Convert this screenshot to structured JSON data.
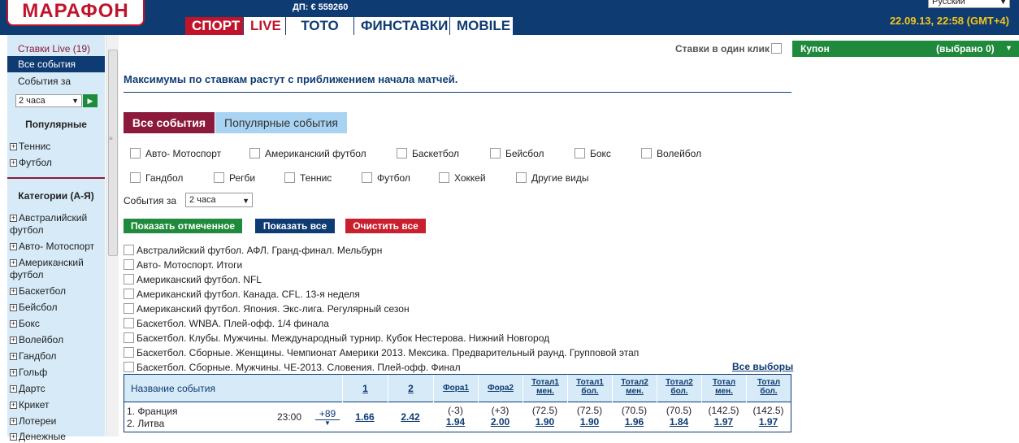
{
  "header": {
    "logo": "МАРАФОН",
    "dp": "ДП: € 559260",
    "tabs": [
      "СПОРТ",
      "LIVE",
      "ТОТО",
      "ФИНСТАВКИ",
      "MOBILE"
    ],
    "language": "Русский",
    "datetime": "22.09.13, 22:58 (GMT+4)"
  },
  "sidebar": {
    "live": "Ставки Live (19)",
    "all_events": "Все события",
    "events_for": "События за",
    "period": "2 часа",
    "popular_title": "Популярные",
    "popular": [
      "Теннис",
      "Футбол"
    ],
    "categories_title": "Категории (А-Я)",
    "categories": [
      "Австралийский футбол",
      "Авто- Мотоспорт",
      "Американский футбол",
      "Баскетбол",
      "Бейсбол",
      "Бокс",
      "Волейбол",
      "Гандбол",
      "Гольф",
      "Дартс",
      "Крикет",
      "Лотереи",
      "Денежные"
    ]
  },
  "topbar": {
    "one_click": "Ставки в один клик",
    "coupon": "Купон",
    "coupon_selected": "(выбрано 0)"
  },
  "main": {
    "notice": "Максимумы по ставкам растут с приближением начала матчей.",
    "tab_all": "Все события",
    "tab_popular": "Популярные события",
    "sports_row1": [
      "Авто- Мотоспорт",
      "Американский футбол",
      "Баскетбол",
      "Бейсбол",
      "Бокс",
      "Волейбол"
    ],
    "sports_row2": [
      "Гандбол",
      "Регби",
      "Теннис",
      "Футбол",
      "Хоккей",
      "Другие виды"
    ],
    "events_for": "События за",
    "period": "2 часа",
    "btn_show_selected": "Показать отмеченное",
    "btn_show_all": "Показать все",
    "btn_clear_all": "Очистить все",
    "events": [
      "Австралийский футбол. АФЛ. Гранд-финал. Мельбурн",
      "Авто- Мотоспорт. Итоги",
      "Американский футбол. NFL",
      "Американский футбол. Канада. CFL. 13-я неделя",
      "Американский футбол. Япония. Экс-лига. Регулярный сезон",
      "Баскетбол. WNBA. Плей-офф. 1/4 финала",
      "Баскетбол. Клубы. Мужчины. Международный турнир. Кубок Нестерова. Нижний Новгород",
      "Баскетбол. Сборные. Женщины. Чемпионат Америки 2013. Мексика. Предварительный раунд. Групповой этап",
      "Баскетбол. Сборные. Мужчины. ЧЕ-2013. Словения. Плей-офф. Финал"
    ],
    "all_choices": "Все выборы"
  },
  "table": {
    "event_name_header": "Название события",
    "columns": [
      {
        "l1": "1",
        "l2": ""
      },
      {
        "l1": "2",
        "l2": ""
      },
      {
        "l1": "Фора1",
        "l2": ""
      },
      {
        "l1": "Фора2",
        "l2": ""
      },
      {
        "l1": "Тотал1",
        "l2": "мен."
      },
      {
        "l1": "Тотал1",
        "l2": "бол."
      },
      {
        "l1": "Тотал2",
        "l2": "мен."
      },
      {
        "l1": "Тотал2",
        "l2": "бол."
      },
      {
        "l1": "Тотал",
        "l2": "мен."
      },
      {
        "l1": "Тотал",
        "l2": "бол."
      }
    ],
    "row": {
      "team1": "1. Франция",
      "team2": "2. Литва",
      "time": "23:00",
      "more": "+89",
      "cells": [
        {
          "top": "",
          "odd": "1.66"
        },
        {
          "top": "",
          "odd": "2.42"
        },
        {
          "top": "(-3)",
          "odd": "1.94"
        },
        {
          "top": "(+3)",
          "odd": "2.00"
        },
        {
          "top": "(72.5)",
          "odd": "1.90"
        },
        {
          "top": "(72.5)",
          "odd": "1.90"
        },
        {
          "top": "(70.5)",
          "odd": "1.96"
        },
        {
          "top": "(70.5)",
          "odd": "1.84"
        },
        {
          "top": "(142.5)",
          "odd": "1.97"
        },
        {
          "top": "(142.5)",
          "odd": "1.97"
        }
      ]
    }
  }
}
